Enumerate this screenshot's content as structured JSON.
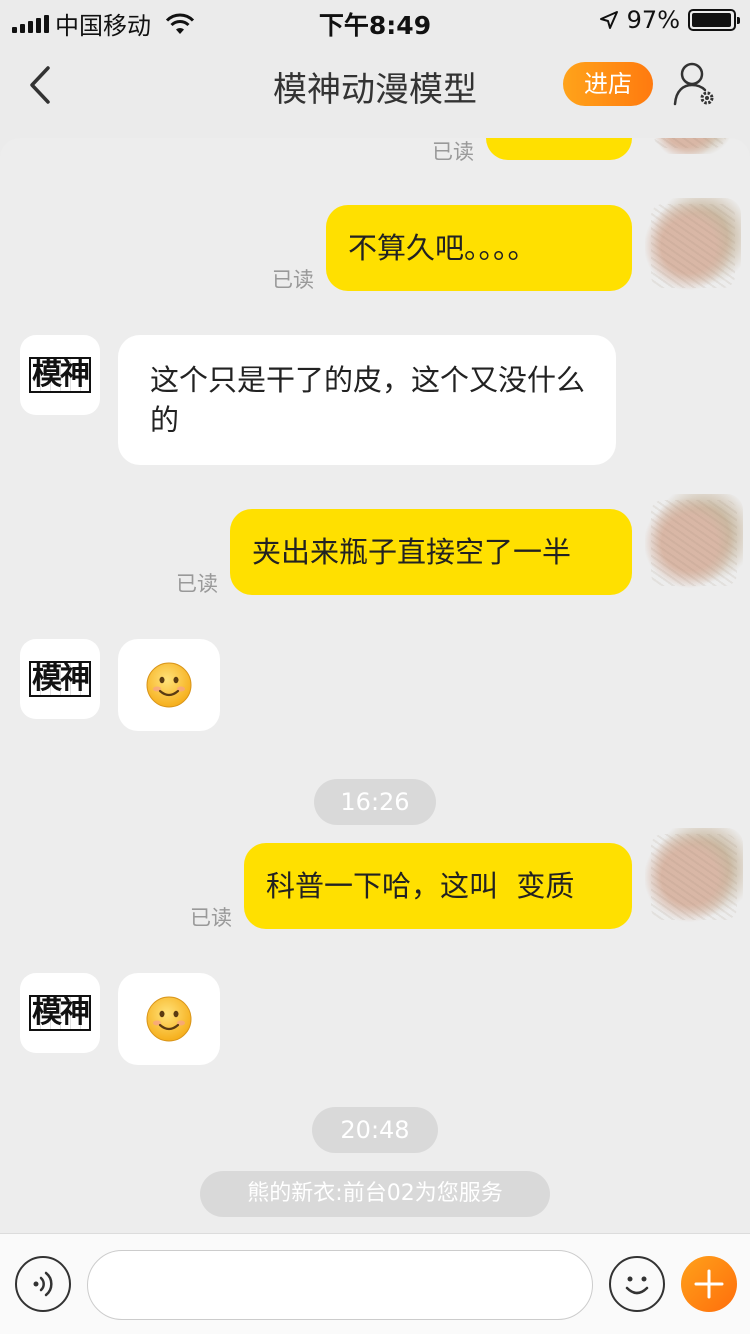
{
  "status_bar": {
    "carrier": "中国移动",
    "time": "下午8:49",
    "battery_percent": "97%",
    "battery_level": 0.97
  },
  "nav": {
    "title": "模神动漫模型",
    "store_button": "进店"
  },
  "messages": {
    "read_label": "已读",
    "m1_text": "不算久吧。。。。",
    "m2_text": "这个只是干了的皮，这个又没什么的",
    "m3_text": "夹出来瓶子直接空了一半",
    "m4_text": "科普一下哈，这叫  变质",
    "time_1": "16:26",
    "time_2": "20:48",
    "system_notice": "熊的新衣:前台02为您服务"
  },
  "shop_avatar_text": "模神",
  "input": {
    "value": "",
    "placeholder": ""
  },
  "icons": {
    "back": "chevron-left-icon",
    "profile": "user-settings-icon",
    "voice": "voice-icon",
    "emoji": "emoji-icon",
    "plus": "plus-icon"
  },
  "colors": {
    "outgoing_bubble": "#ffe000",
    "incoming_bubble": "#ffffff",
    "accent_orange": "#ff8a14",
    "background": "#ededed"
  }
}
